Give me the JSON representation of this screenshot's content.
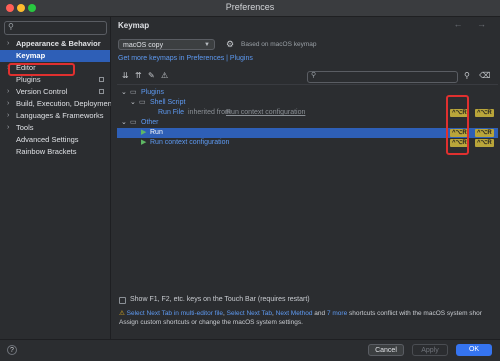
{
  "window": {
    "title": "Preferences"
  },
  "sidebar": {
    "search_placeholder": "",
    "items": [
      {
        "label": "Appearance & Behavior",
        "chevron": "›",
        "bold": true
      },
      {
        "label": "Keymap",
        "chevron": "",
        "selected": true
      },
      {
        "label": "Editor",
        "chevron": "›"
      },
      {
        "label": "Plugins",
        "chevron": "",
        "badge": true
      },
      {
        "label": "Version Control",
        "chevron": "›",
        "badge": true
      },
      {
        "label": "Build, Execution, Deployment",
        "chevron": "›"
      },
      {
        "label": "Languages & Frameworks",
        "chevron": "›"
      },
      {
        "label": "Tools",
        "chevron": "›"
      },
      {
        "label": "Advanced Settings",
        "chevron": ""
      },
      {
        "label": "Rainbow Brackets",
        "chevron": ""
      }
    ]
  },
  "main": {
    "title": "Keymap",
    "nav_arrows": "← →",
    "keymap_select": "macOS copy",
    "based_on": "Based on macOS keymap",
    "more_link": "Get more keymaps in Preferences | Plugins",
    "find_placeholder": ""
  },
  "tree": {
    "rows": [
      {
        "text": "Plugins",
        "level": 0,
        "chevron": "⌄",
        "type": "folder",
        "blue": true
      },
      {
        "text": "Shell Script",
        "level": 1,
        "chevron": "⌄",
        "type": "folder",
        "blue": true
      },
      {
        "text": "Run File",
        "level": 2,
        "type": "action",
        "suffix": "inherited from",
        "suffix_link": "Run context configuration",
        "keys": [
          "^⌥R",
          "^⌥R"
        ]
      },
      {
        "text": "Other",
        "level": 0,
        "chevron": "⌄",
        "type": "folder",
        "blue": true
      },
      {
        "text": "Run",
        "level": 1,
        "type": "play",
        "selected": true,
        "keys": [
          "^⌥R",
          "^⌥R"
        ]
      },
      {
        "text": "Run context configuration",
        "level": 1,
        "type": "play",
        "blue": true,
        "keys": [
          "^⌥R",
          "^⌥R"
        ]
      }
    ]
  },
  "bottom": {
    "touchbar_checkbox": "Show F1, F2, etc. keys on the Touch Bar (requires restart)",
    "warn_prefix": "",
    "warn_link1": "Select Next Tab in multi-editor file",
    "warn_sep1": ", ",
    "warn_link2": "Select Next Tab",
    "warn_sep2": ", ",
    "warn_link3": "Next Method",
    "warn_and": " and ",
    "warn_link4": "7 more",
    "warn_rest": " shortcuts conflict with the macOS system shor",
    "warn_line2": "Assign custom shortcuts or change the macOS system settings."
  },
  "footer": {
    "help": "?",
    "cancel": "Cancel",
    "apply": "Apply",
    "ok": "OK"
  },
  "colors": {
    "accent": "#3574f0",
    "selection": "#2e5fb7",
    "link": "#5e9af2",
    "highlight_box": "#e0302f",
    "shortcut": "#b9a53a"
  }
}
